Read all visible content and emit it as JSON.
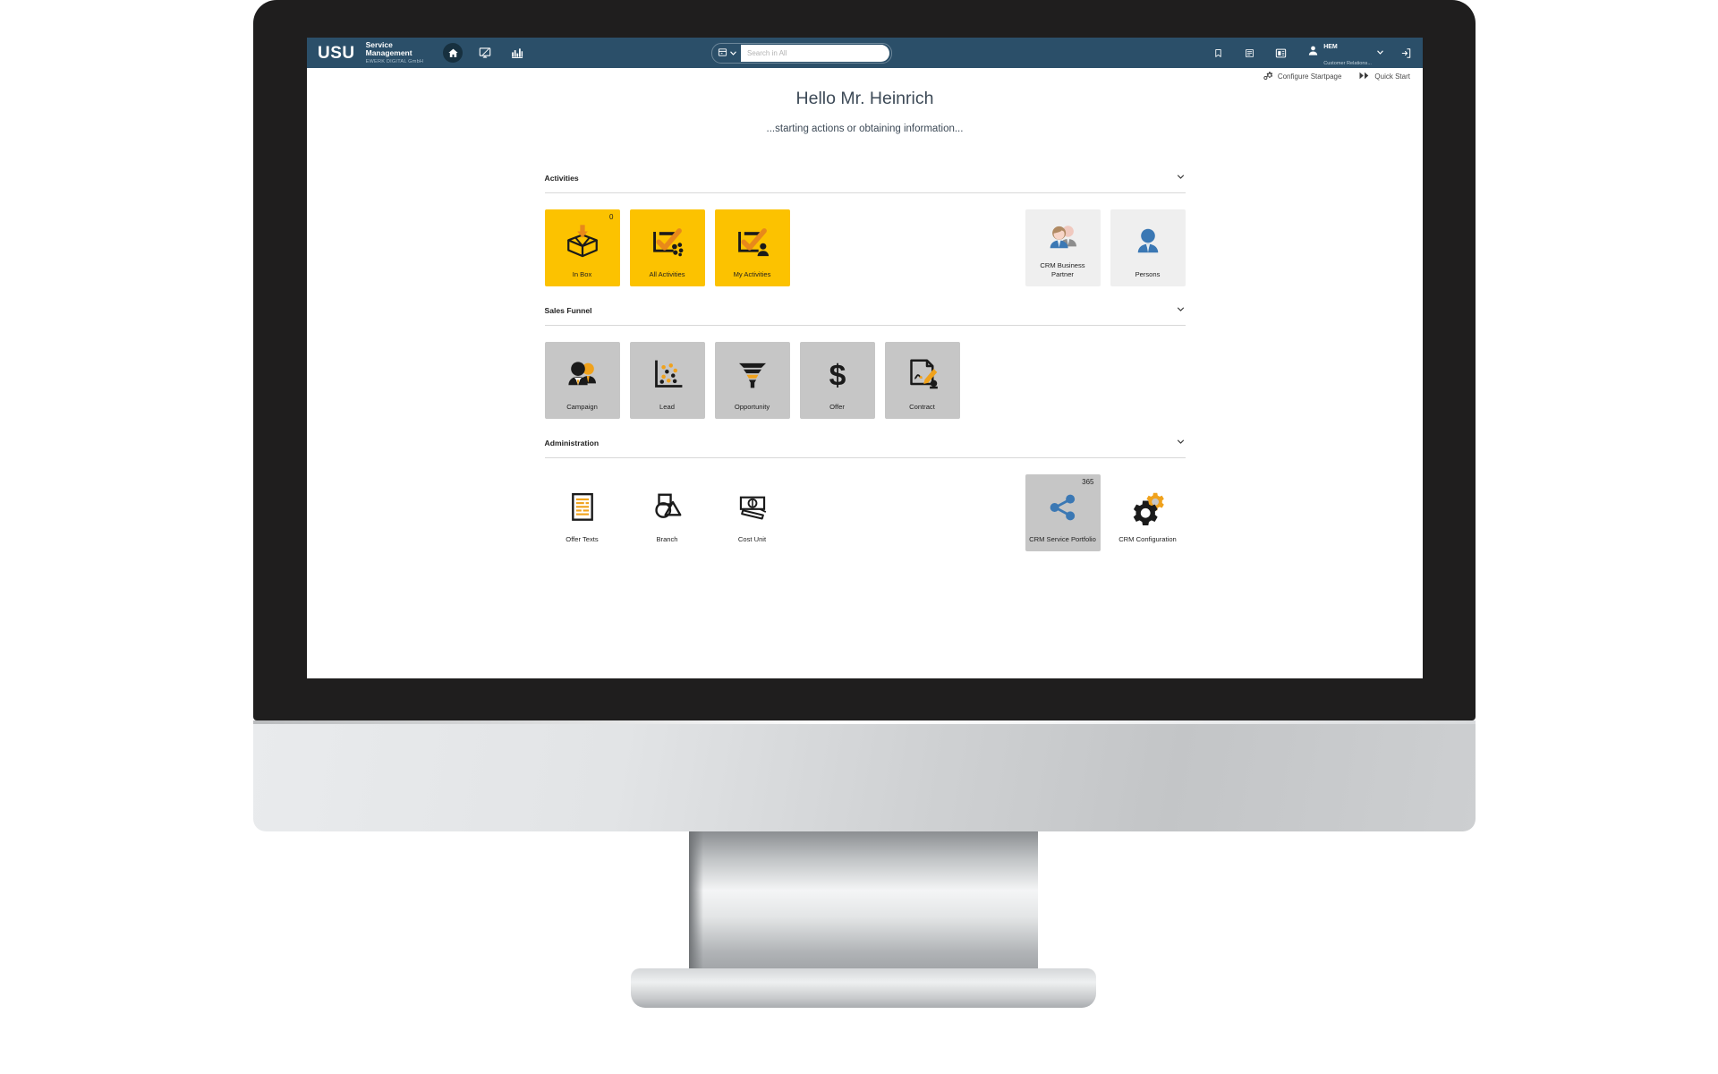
{
  "header": {
    "logo": "USU",
    "product_line1": "Service",
    "product_line2": "Management",
    "company": "EWERK DIGITAL GmbH",
    "nav_icons": [
      {
        "name": "home-icon",
        "label": "Home"
      },
      {
        "name": "screen-edit-icon",
        "label": "Workspace"
      },
      {
        "name": "chart-bars-icon",
        "label": "Reports"
      }
    ],
    "search": {
      "placeholder": "Search in All",
      "value": "",
      "scope_icon": "search-scope-icon",
      "dropdown_icon": "chevron-down-icon"
    },
    "right_icons": [
      {
        "name": "bookmark-icon",
        "label": "Bookmarks"
      },
      {
        "name": "list-icon",
        "label": "Lists"
      },
      {
        "name": "card-icon",
        "label": "Cards"
      }
    ],
    "user": {
      "name": "HEM",
      "role": "Customer Relations...",
      "avatar_icon": "user-avatar-icon",
      "dropdown_icon": "chevron-down-icon"
    },
    "logout": {
      "name": "logout-icon",
      "label": "Logout"
    }
  },
  "toolbar": {
    "configure_label": "Configure Startpage",
    "configure_icon": "gear-settings-icon",
    "quickstart_label": "Quick Start",
    "quickstart_icon": "fast-forward-icon"
  },
  "page": {
    "greeting": "Hello Mr. Heinrich",
    "subgreeting": "...starting actions or obtaining information..."
  },
  "sections": [
    {
      "id": "activities",
      "title": "Activities",
      "chevron_icon": "chevron-down-icon",
      "left_tiles": [
        {
          "label": "In Box",
          "icon": "inbox-open-box-icon",
          "style": "yellow",
          "badge": "0"
        },
        {
          "label": "All Activities",
          "icon": "checkbox-group-icon",
          "style": "yellow",
          "badge": ""
        },
        {
          "label": "My Activities",
          "icon": "checkbox-person-icon",
          "style": "yellow",
          "badge": ""
        }
      ],
      "right_tiles": [
        {
          "label": "CRM Business Partner",
          "icon": "two-persons-icon",
          "style": "lightgrey",
          "badge": ""
        },
        {
          "label": "Persons",
          "icon": "person-icon",
          "style": "lightgrey",
          "badge": ""
        }
      ]
    },
    {
      "id": "sales-funnel",
      "title": "Sales Funnel",
      "chevron_icon": "chevron-down-icon",
      "left_tiles": [
        {
          "label": "Campaign",
          "icon": "campaign-persons-icon",
          "style": "grey",
          "badge": ""
        },
        {
          "label": "Lead",
          "icon": "scatter-chart-icon",
          "style": "grey",
          "badge": ""
        },
        {
          "label": "Opportunity",
          "icon": "funnel-icon",
          "style": "grey",
          "badge": ""
        },
        {
          "label": "Offer",
          "icon": "dollar-sign-icon",
          "style": "grey",
          "badge": ""
        },
        {
          "label": "Contract",
          "icon": "contract-signature-icon",
          "style": "grey",
          "badge": ""
        }
      ],
      "right_tiles": []
    },
    {
      "id": "administration",
      "title": "Administration",
      "chevron_icon": "chevron-down-icon",
      "left_tiles": [
        {
          "label": "Offer Texts",
          "icon": "document-lines-icon",
          "style": "plain",
          "badge": ""
        },
        {
          "label": "Branch",
          "icon": "shapes-icon",
          "style": "plain",
          "badge": ""
        },
        {
          "label": "Cost Unit",
          "icon": "banknotes-icon",
          "style": "plain",
          "badge": ""
        }
      ],
      "right_tiles": [
        {
          "label": "CRM Service Portfolio",
          "icon": "share-network-icon",
          "style": "grey",
          "badge": "365"
        },
        {
          "label": "CRM Configuration",
          "icon": "gears-icon",
          "style": "plain",
          "badge": ""
        }
      ]
    }
  ],
  "colors": {
    "header_blue": "#2b4f69",
    "accent_yellow": "#fcc200",
    "accent_orange": "#f0a21c",
    "tile_grey": "#c6c6c6",
    "tile_light_grey": "#efefef",
    "person_blue": "#3b78b4"
  }
}
